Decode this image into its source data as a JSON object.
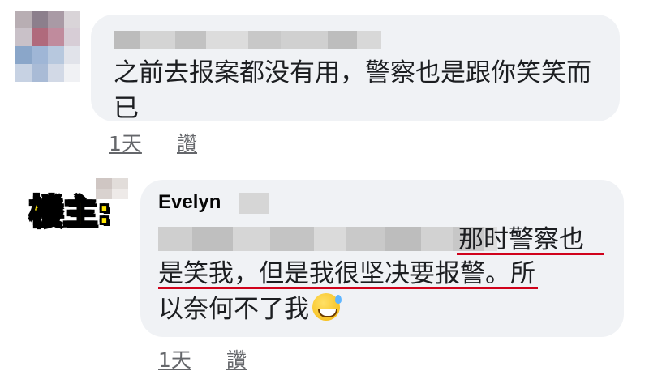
{
  "comment1": {
    "text": "之前去报案都没有用，警察也是跟你笑笑而已",
    "time": "1天",
    "like": "讚"
  },
  "reply": {
    "badge": "楼主:",
    "author": "Evelyn",
    "line1_visible": "那时警察也",
    "line2": "是笑我，但是我很坚决要报警。所",
    "line3": "以奈何不了我",
    "emoji": "grinning-face-with-sweat-icon",
    "time": "1天",
    "like": "讚"
  },
  "colors": {
    "bubble": "#f0f2f5",
    "underline": "#d0021b",
    "badge_fill": "#ffe600",
    "meta": "#65676b"
  }
}
